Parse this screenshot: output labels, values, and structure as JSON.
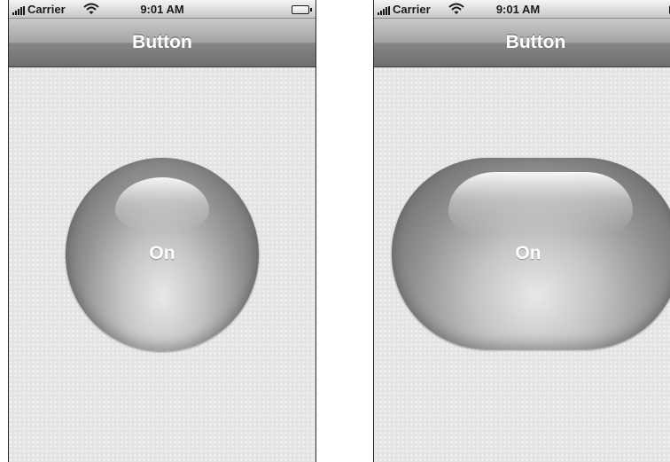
{
  "screens": [
    {
      "status_bar": {
        "carrier": "Carrier",
        "time": "9:01 AM"
      },
      "nav_bar": {
        "title": "Button"
      },
      "button": {
        "label": "On",
        "shape": "circle"
      }
    },
    {
      "status_bar": {
        "carrier": "Carrier",
        "time": "9:01 AM"
      },
      "nav_bar": {
        "title": "Button"
      },
      "button": {
        "label": "On",
        "shape": "pill"
      }
    }
  ],
  "colors": {
    "nav_bar": "#8c8c8c",
    "content_background": "#e4e4e4",
    "title_text": "#ffffff"
  },
  "icons": [
    "signal-strength-icon",
    "wifi-icon",
    "battery-icon"
  ]
}
